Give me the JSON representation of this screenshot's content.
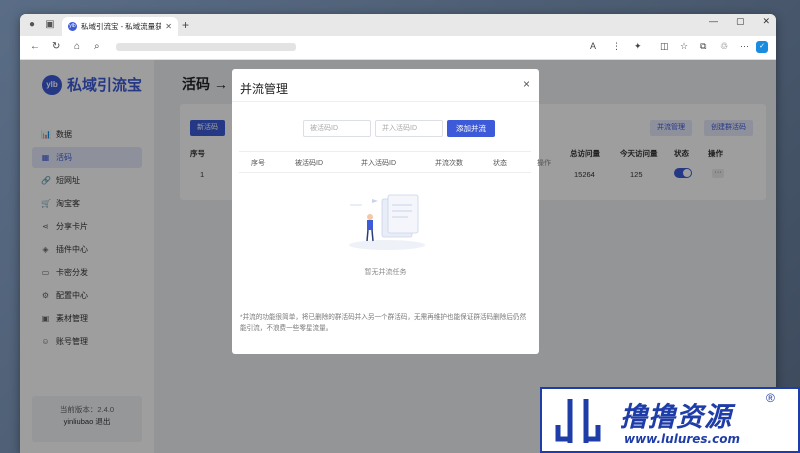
{
  "browser": {
    "tab_title": "私域引流宝 - 私域流量获取与维护",
    "tab_favicon": "ylb",
    "window_buttons": [
      "—",
      "▢",
      "✕"
    ]
  },
  "sidebar": {
    "logo_mark": "ylb",
    "logo_text": "私域引流宝",
    "items": [
      {
        "icon": "chart-icon",
        "glyph": "📊",
        "label": "数据",
        "active": false
      },
      {
        "icon": "qrcode-icon",
        "glyph": "▦",
        "label": "活码",
        "active": true
      },
      {
        "icon": "link-icon",
        "glyph": "🔗",
        "label": "短网址",
        "active": false
      },
      {
        "icon": "cart-icon",
        "glyph": "🛒",
        "label": "淘宝客",
        "active": false
      },
      {
        "icon": "share-icon",
        "glyph": "⋖",
        "label": "分享卡片",
        "active": false
      },
      {
        "icon": "plugin-icon",
        "glyph": "◈",
        "label": "插件中心",
        "active": false
      },
      {
        "icon": "card-icon",
        "glyph": "▭",
        "label": "卡密分发",
        "active": false
      },
      {
        "icon": "config-icon",
        "glyph": "⚙",
        "label": "配置中心",
        "active": false
      },
      {
        "icon": "image-icon",
        "glyph": "▣",
        "label": "素材管理",
        "active": false
      },
      {
        "icon": "user-icon",
        "glyph": "☺",
        "label": "账号管理",
        "active": false
      }
    ],
    "version_label": "当前版本：2.4.0",
    "user_label": "yinliubao 退出"
  },
  "main": {
    "title": "活码 →",
    "create_btn": "新活码",
    "merge_btn": "并流管理",
    "create_group_btn": "创建群活码",
    "table": {
      "headers": [
        "序号",
        "总访问量",
        "今天访问量",
        "状态",
        "操作"
      ],
      "row": {
        "index": "1",
        "total": "15264",
        "today": "125",
        "more": "···"
      }
    }
  },
  "modal": {
    "title": "并流管理",
    "close": "×",
    "input1_placeholder": "被活码ID",
    "input2_placeholder": "并入活码ID",
    "add_button": "添加并流",
    "headers": [
      "序号",
      "被活码ID",
      "并入活码ID",
      "并流次数",
      "状态",
      "操作"
    ],
    "empty_text": "暂无并流任务",
    "note": "*并流的功能很简单，将已删除的群活码并入另一个群活码，无需再维护也能保证群活码删除后仍然能引流，不浪费一些零星流量。"
  },
  "watermark": {
    "title": "撸撸资源",
    "reg": "®",
    "url": "www.lulures.com"
  },
  "colors": {
    "primary": "#3d5bd9",
    "watermark": "#1f3da8"
  }
}
